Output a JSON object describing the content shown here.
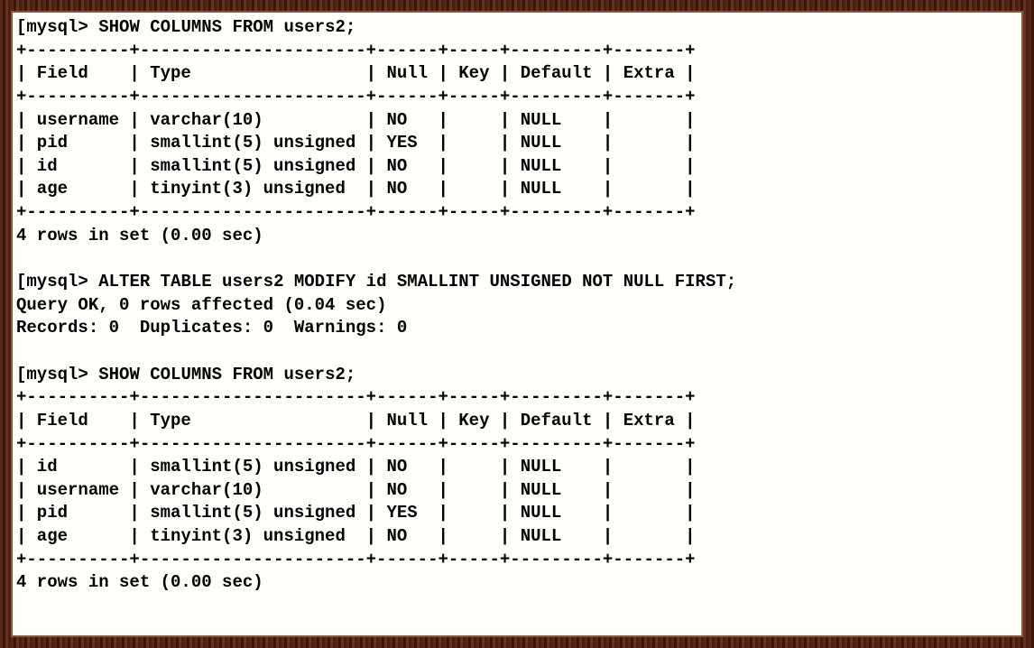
{
  "prompt": "mysql>",
  "bracket": "[",
  "commands": {
    "show_columns_1": "SHOW COLUMNS FROM users2;",
    "alter": "ALTER TABLE users2 MODIFY id SMALLINT UNSIGNED NOT NULL FIRST;",
    "show_columns_2": "SHOW COLUMNS FROM users2;"
  },
  "table_headers": {
    "field": "Field",
    "type": "Type",
    "null": "Null",
    "key": "Key",
    "default": "Default",
    "extra": "Extra"
  },
  "table1_rows": [
    {
      "field": "username",
      "type": "varchar(10)",
      "null": "NO",
      "key": "",
      "default": "NULL",
      "extra": ""
    },
    {
      "field": "pid",
      "type": "smallint(5) unsigned",
      "null": "YES",
      "key": "",
      "default": "NULL",
      "extra": ""
    },
    {
      "field": "id",
      "type": "smallint(5) unsigned",
      "null": "NO",
      "key": "",
      "default": "NULL",
      "extra": ""
    },
    {
      "field": "age",
      "type": "tinyint(3) unsigned",
      "null": "NO",
      "key": "",
      "default": "NULL",
      "extra": ""
    }
  ],
  "table2_rows": [
    {
      "field": "id",
      "type": "smallint(5) unsigned",
      "null": "NO",
      "key": "",
      "default": "NULL",
      "extra": ""
    },
    {
      "field": "username",
      "type": "varchar(10)",
      "null": "NO",
      "key": "",
      "default": "NULL",
      "extra": ""
    },
    {
      "field": "pid",
      "type": "smallint(5) unsigned",
      "null": "YES",
      "key": "",
      "default": "NULL",
      "extra": ""
    },
    {
      "field": "age",
      "type": "tinyint(3) unsigned",
      "null": "NO",
      "key": "",
      "default": "NULL",
      "extra": ""
    }
  ],
  "result_msg_1": "4 rows in set (0.00 sec)",
  "alter_ok": "Query OK, 0 rows affected (0.04 sec)",
  "alter_records": "Records: 0  Duplicates: 0  Warnings: 0",
  "result_msg_2_partial": "4 rows in set (0.00 sec)",
  "border": "+----------+----------------------+------+-----+---------+-------+",
  "col_widths": {
    "field": 8,
    "type": 20,
    "null": 4,
    "key": 3,
    "default": 7,
    "extra": 5
  }
}
